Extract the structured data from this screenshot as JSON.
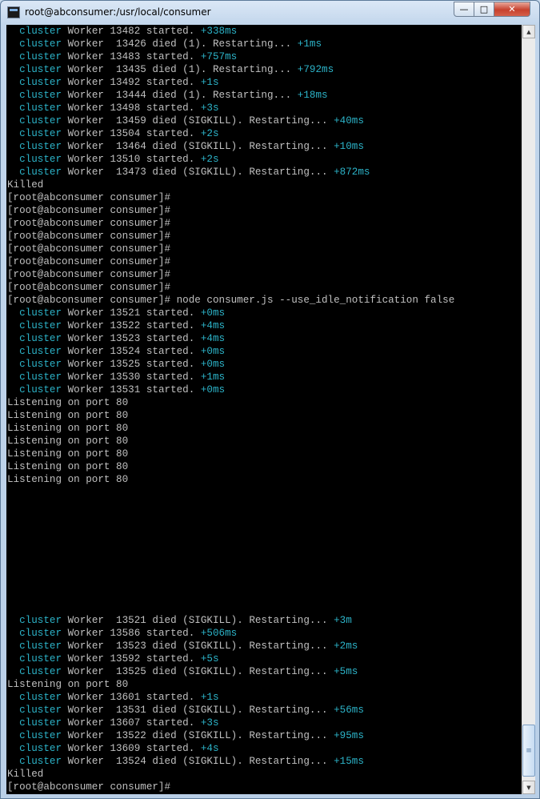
{
  "window": {
    "title": "root@abconsumer:/usr/local/consumer",
    "minimize_glyph": "—",
    "maximize_glyph": "□",
    "close_glyph": "✕",
    "icons": [
      "terminal-app-icon",
      "minimize-icon",
      "maximize-icon",
      "close-icon",
      "scroll-up-icon",
      "scroll-down-icon",
      "scroll-thumb-grip-icon"
    ]
  },
  "colors": {
    "console_bg": "#000000",
    "console_fg": "#c0c0c0",
    "highlight": "#2cb3c8",
    "close_red": "#c7412d"
  },
  "scrollbar": {
    "up_glyph": "▲",
    "down_glyph": "▼",
    "thumb_glyph": "≡"
  },
  "terminal": {
    "lines": [
      {
        "type": "worker",
        "pre": "Worker 13482 started. ",
        "dt": "+338ms"
      },
      {
        "type": "worker",
        "pre": "Worker  13426 died (1). Restarting... ",
        "dt": "+1ms"
      },
      {
        "type": "worker",
        "pre": "Worker 13483 started. ",
        "dt": "+757ms"
      },
      {
        "type": "worker",
        "pre": "Worker  13435 died (1). Restarting... ",
        "dt": "+792ms"
      },
      {
        "type": "worker",
        "pre": "Worker 13492 started. ",
        "dt": "+1s"
      },
      {
        "type": "worker",
        "pre": "Worker  13444 died (1). Restarting... ",
        "dt": "+18ms"
      },
      {
        "type": "worker",
        "pre": "Worker 13498 started. ",
        "dt": "+3s"
      },
      {
        "type": "worker",
        "pre": "Worker  13459 died (SIGKILL). Restarting... ",
        "dt": "+40ms"
      },
      {
        "type": "worker",
        "pre": "Worker 13504 started. ",
        "dt": "+2s"
      },
      {
        "type": "worker",
        "pre": "Worker  13464 died (SIGKILL). Restarting... ",
        "dt": "+10ms"
      },
      {
        "type": "worker",
        "pre": "Worker 13510 started. ",
        "dt": "+2s"
      },
      {
        "type": "worker",
        "pre": "Worker  13473 died (SIGKILL). Restarting... ",
        "dt": "+872ms"
      },
      {
        "type": "text",
        "text": "Killed"
      },
      {
        "type": "text",
        "text": "[root@abconsumer consumer]#"
      },
      {
        "type": "text",
        "text": "[root@abconsumer consumer]#"
      },
      {
        "type": "text",
        "text": "[root@abconsumer consumer]#"
      },
      {
        "type": "text",
        "text": "[root@abconsumer consumer]#"
      },
      {
        "type": "text",
        "text": "[root@abconsumer consumer]#"
      },
      {
        "type": "text",
        "text": "[root@abconsumer consumer]#"
      },
      {
        "type": "text",
        "text": "[root@abconsumer consumer]#"
      },
      {
        "type": "text",
        "text": "[root@abconsumer consumer]#"
      },
      {
        "type": "text",
        "text": "[root@abconsumer consumer]# node consumer.js --use_idle_notification false"
      },
      {
        "type": "worker",
        "pre": "Worker 13521 started. ",
        "dt": "+0ms"
      },
      {
        "type": "worker",
        "pre": "Worker 13522 started. ",
        "dt": "+4ms"
      },
      {
        "type": "worker",
        "pre": "Worker 13523 started. ",
        "dt": "+4ms"
      },
      {
        "type": "worker",
        "pre": "Worker 13524 started. ",
        "dt": "+0ms"
      },
      {
        "type": "worker",
        "pre": "Worker 13525 started. ",
        "dt": "+0ms"
      },
      {
        "type": "worker",
        "pre": "Worker 13530 started. ",
        "dt": "+1ms"
      },
      {
        "type": "worker",
        "pre": "Worker 13531 started. ",
        "dt": "+0ms"
      },
      {
        "type": "text",
        "text": "Listening on port 80"
      },
      {
        "type": "text",
        "text": "Listening on port 80"
      },
      {
        "type": "text",
        "text": "Listening on port 80"
      },
      {
        "type": "text",
        "text": "Listening on port 80"
      },
      {
        "type": "text",
        "text": "Listening on port 80"
      },
      {
        "type": "text",
        "text": "Listening on port 80"
      },
      {
        "type": "text",
        "text": "Listening on port 80"
      },
      {
        "type": "blank"
      },
      {
        "type": "blank"
      },
      {
        "type": "blank"
      },
      {
        "type": "blank"
      },
      {
        "type": "blank"
      },
      {
        "type": "blank"
      },
      {
        "type": "blank"
      },
      {
        "type": "blank"
      },
      {
        "type": "blank"
      },
      {
        "type": "blank"
      },
      {
        "type": "worker",
        "pre": "Worker  13521 died (SIGKILL). Restarting... ",
        "dt": "+3m"
      },
      {
        "type": "worker",
        "pre": "Worker 13586 started. ",
        "dt": "+506ms"
      },
      {
        "type": "worker",
        "pre": "Worker  13523 died (SIGKILL). Restarting... ",
        "dt": "+2ms"
      },
      {
        "type": "worker",
        "pre": "Worker 13592 started. ",
        "dt": "+5s"
      },
      {
        "type": "worker",
        "pre": "Worker  13525 died (SIGKILL). Restarting... ",
        "dt": "+5ms"
      },
      {
        "type": "text",
        "text": "Listening on port 80"
      },
      {
        "type": "worker",
        "pre": "Worker 13601 started. ",
        "dt": "+1s"
      },
      {
        "type": "worker",
        "pre": "Worker  13531 died (SIGKILL). Restarting... ",
        "dt": "+56ms"
      },
      {
        "type": "worker",
        "pre": "Worker 13607 started. ",
        "dt": "+3s"
      },
      {
        "type": "worker",
        "pre": "Worker  13522 died (SIGKILL). Restarting... ",
        "dt": "+95ms"
      },
      {
        "type": "worker",
        "pre": "Worker 13609 started. ",
        "dt": "+4s"
      },
      {
        "type": "worker",
        "pre": "Worker  13524 died (SIGKILL). Restarting... ",
        "dt": "+15ms"
      },
      {
        "type": "text",
        "text": "Killed"
      },
      {
        "type": "text",
        "text": "[root@abconsumer consumer]#"
      }
    ],
    "tag_label": "cluster"
  }
}
